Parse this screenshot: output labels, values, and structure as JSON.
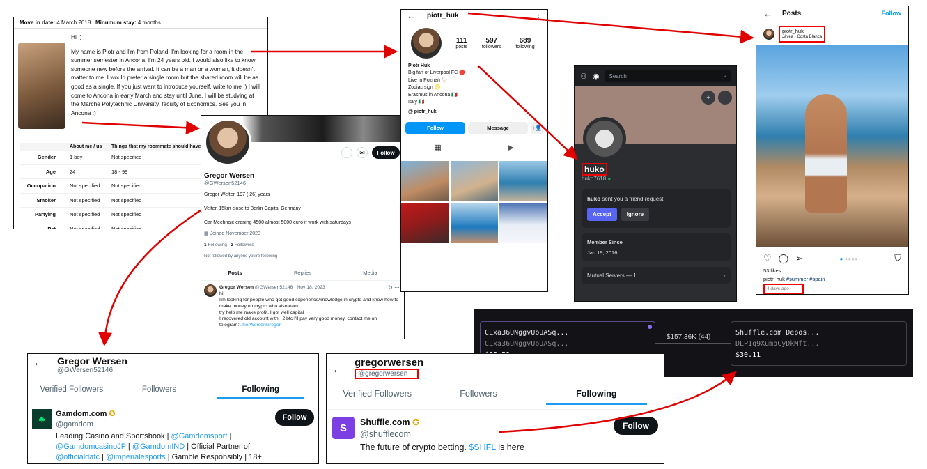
{
  "listing": {
    "move_in_label": "Move in date:",
    "move_in": "4 March 2018",
    "min_stay_label": "Minumum stay:",
    "min_stay": "4 months",
    "greeting": "Hi :)",
    "bio": "My name is Piotr and I'm from Poland. I'm looking for a room in the summer semester in Ancona. I'm 24 years old. I would also like to know someone new before the arrival. It can be a man or a woman, it doesn't matter to me. I would prefer a single room but the shared room will be as good as a single. If you just want to introduce yourself, write to me :) I will come to Ancona in early March and stay until June. I will be studying at the Marche Polytechnic University, faculty of Economics. See you in Ancona :)",
    "col1": "About me / us",
    "col2": "Things that my roommate should have",
    "rows": [
      {
        "label": "Gender",
        "me": "1 boy",
        "mate": "Not specified"
      },
      {
        "label": "Age",
        "me": "24",
        "mate": "18 - 99"
      },
      {
        "label": "Occupation",
        "me": "Not specified",
        "mate": "Not specified"
      },
      {
        "label": "Smoker",
        "me": "Not specified",
        "mate": "Not specified"
      },
      {
        "label": "Partying",
        "me": "Not specified",
        "mate": "Not specified"
      },
      {
        "label": "Pet",
        "me": "Not specified",
        "mate": "Not specified"
      }
    ]
  },
  "x_profile": {
    "name": "Gregor Wersen",
    "handle": "@GWersen52146",
    "follow": "Follow",
    "bio1": "Gregor Welten 197 ( 26) years",
    "bio2": "Velten 15km close to Berlin Capital Germany",
    "bio3": "Car Mechnaic eraning 4500 almost 5000 euro if work with saturdays",
    "joined": "Joined November 2023",
    "following_count": "1",
    "following_label": "Following",
    "followers_count": "3",
    "followers_label": "Followers",
    "not_followed": "Not followed by anyone you're following",
    "tabs": [
      "Posts",
      "Replies",
      "Media"
    ],
    "post_name": "Gregor Wersen",
    "post_meta": "@GWersen52146 · Nov 18, 2023",
    "post_l1": "hi!",
    "post_l2": "I'm looking for people who got good experience/knowledge in crypto and know how to make money on crypto who also earn.",
    "post_l3": "try help me make profit, I got well capital",
    "post_l4": "I recovered old account with +2 btc I'll pay very good money. contact me on",
    "post_l5a": "telegram:",
    "post_l5b": "t.me/WersenGregor"
  },
  "ig_profile": {
    "username": "piotr_huk",
    "posts_n": "111",
    "posts_l": "posts",
    "followers_n": "597",
    "followers_l": "followers",
    "following_n": "689",
    "following_l": "following",
    "name": "Piotr Huk",
    "b1": "Big fan of Liverpool FC 🔴",
    "b2": "Live in Poznań 🦙",
    "b3": "Zodiac sign ♌",
    "b4": "Erasmus in Ancona 🇮🇹",
    "b5": "Italy 🇮🇹",
    "threads": "piotr_huk",
    "follow": "Follow",
    "message": "Message"
  },
  "ig_post": {
    "title": "Posts",
    "follow": "Follow",
    "username": "piotr_huk",
    "location": "Jávea - Costa Blanca",
    "likes": "53 likes",
    "caption_user": "piotr_huk",
    "caption_tags": "#summer #spain",
    "time": "4 days ago"
  },
  "discord": {
    "search": "Search",
    "name": "huko",
    "tag": "huko7618",
    "request": "sent you a friend request.",
    "accept": "Accept",
    "ignore": "Ignore",
    "member_label": "Member Since",
    "member_date": "Jan 19, 2016",
    "mutual": "Mutual Servers — 1"
  },
  "tx": {
    "left1": "CLxa36UNggvUbUASq...",
    "left2": "CLxa36UNggvUbUASq...",
    "left_amt": "$15.59",
    "mid": "$157.36K (44)",
    "right1": "Shuffle.com Depos...",
    "right2": "DLP1q9XumoCyDkMft...",
    "right_amt": "$30.11"
  },
  "x_following_a": {
    "name": "Gregor Wersen",
    "handle": "@GWersen52146",
    "tabs": [
      "Verified Followers",
      "Followers",
      "Following"
    ],
    "acct_name": "Gamdom.com",
    "acct_handle": "@gamdom",
    "follow": "Follow",
    "bio_a": "Leading Casino and Sportsbook |",
    "link1": "@Gamdomsport",
    "sep1": "|",
    "link2": "@GamdomcasinoJP",
    "sep2": "|",
    "link3": "@GamdomIND",
    "bio_b": "| Official Partner of",
    "link4": "@officialdafc",
    "sep3": "|",
    "link5": "@imperialesports",
    "sep4": "|",
    "bio_c": "Gamble Responsibly | 18+"
  },
  "x_following_b": {
    "name": "gregorwersen",
    "handle": "@gregorwersen",
    "tabs": [
      "Verified Followers",
      "Followers",
      "Following"
    ],
    "acct_name": "Shuffle.com",
    "acct_handle": "@shufflecom",
    "follow": "Follow",
    "bio": "The future of crypto betting.",
    "cashtag": "$SHFL",
    "bio_end": "is here"
  },
  "colors": {
    "x_blue": "#1d9bf0",
    "ig_blue": "#0095f6",
    "discord_blurple": "#5865f2",
    "arrow_red": "#e00000"
  }
}
